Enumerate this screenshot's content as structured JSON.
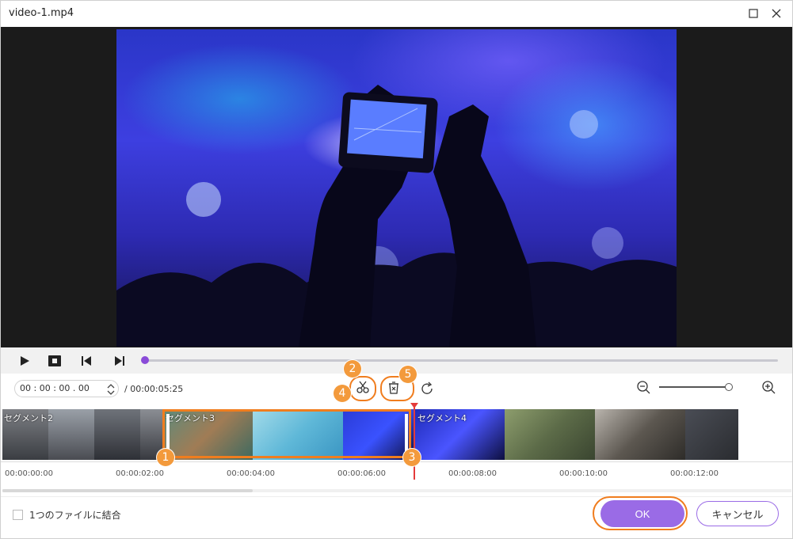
{
  "window": {
    "title": "video-1.mp4"
  },
  "player": {
    "current_time": "00 : 00 : 00 . 00",
    "duration": "/ 00:00:05:25",
    "progress": 0.0
  },
  "timeline": {
    "segments": [
      {
        "label": "セグメント2"
      },
      {
        "label": "セグメント3"
      },
      {
        "label": "セグメント4"
      }
    ],
    "ticks": [
      "00:00:00:00",
      "00:00:02:00",
      "00:00:04:00",
      "00:00:06:00",
      "00:00:08:00",
      "00:00:10:00",
      "00:00:12:00"
    ],
    "zoom_level": 0.92
  },
  "badges": [
    "1",
    "2",
    "3",
    "4",
    "5"
  ],
  "footer": {
    "merge_label": "1つのファイルに結合",
    "ok_label": "OK",
    "cancel_label": "キャンセル"
  },
  "colors": {
    "accent": "#9a6be6",
    "highlight": "#f07d1e",
    "badge": "#f39a3c",
    "playhead": "#e43b3b"
  },
  "icons": [
    "maximize-icon",
    "close-icon",
    "play-icon",
    "stop-icon",
    "prev-frame-icon",
    "next-frame-icon",
    "scissors-icon",
    "delete-segment-icon",
    "reset-icon",
    "zoom-out-icon",
    "zoom-in-icon"
  ]
}
